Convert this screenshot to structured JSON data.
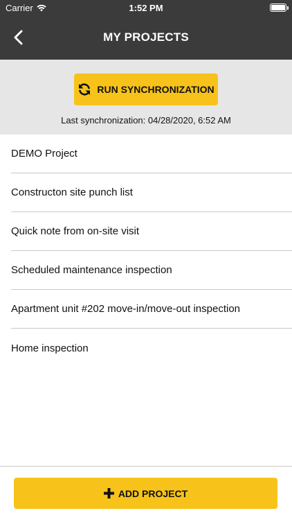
{
  "status_bar": {
    "carrier": "Carrier",
    "time": "1:52 PM",
    "wifi_icon": "wifi-icon",
    "battery_icon": "battery-icon"
  },
  "nav": {
    "title": "MY PROJECTS",
    "back_icon": "chevron-left-icon"
  },
  "sync": {
    "button_label": "RUN SYNCHRONIZATION",
    "button_icon": "sync-icon",
    "last_sync_text": "Last synchronization: 04/28/2020, 6:52 AM"
  },
  "projects": [
    {
      "name": "DEMO Project"
    },
    {
      "name": "Constructon site punch list"
    },
    {
      "name": "Quick note from on-site visit"
    },
    {
      "name": "Scheduled maintenance inspection"
    },
    {
      "name": "Apartment unit #202 move-in/move-out inspection"
    },
    {
      "name": "Home inspection"
    }
  ],
  "footer": {
    "add_label": "ADD PROJECT",
    "add_icon": "plus-icon"
  },
  "colors": {
    "header": "#3b3b3b",
    "accent": "#f7c31b",
    "sync_panel": "#e6e6e6"
  }
}
